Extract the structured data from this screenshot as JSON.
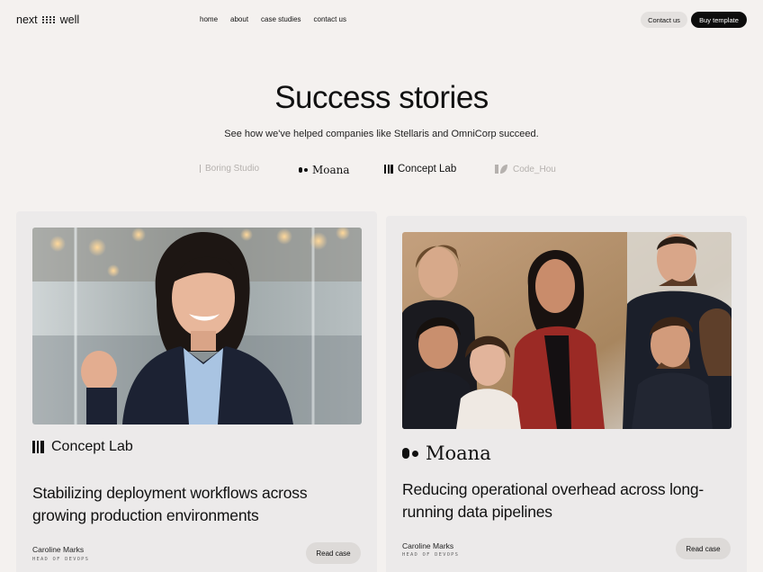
{
  "nav": {
    "logo_left": "next",
    "logo_right": "well",
    "links": [
      "home",
      "about",
      "case studies",
      "contact us"
    ],
    "contact_label": "Contact us",
    "buy_label": "Buy template"
  },
  "hero": {
    "title": "Success stories",
    "subtitle": "See how we've helped companies like Stellaris and OmniCorp succeed."
  },
  "logo_strip": [
    {
      "name": "Boring Studio",
      "icon": "boring-studio-icon"
    },
    {
      "name": "Moana",
      "icon": "moana-icon"
    },
    {
      "name": "Concept Lab",
      "icon": "concept-lab-icon"
    },
    {
      "name": "Code_Hou",
      "icon": "code-house-icon"
    }
  ],
  "cards": [
    {
      "brand": "Concept Lab",
      "brand_icon": "concept-lab-icon",
      "title": "Stabilizing deployment workflows across growing production environments",
      "person_name": "Caroline Marks",
      "person_role": "HEAD OF DEVOPS",
      "button_label": "Read case"
    },
    {
      "brand": "Moana",
      "brand_icon": "moana-icon",
      "title": "Reducing operational overhead across long-running data pipelines",
      "person_name": "Caroline Marks",
      "person_role": "HEAD OF DEVOPS",
      "button_label": "Read case"
    }
  ],
  "colors": {
    "background": "#f4f1ef",
    "card": "#eceaea",
    "primary_button": "#0d0d0d",
    "secondary_button": "#e4e1df"
  }
}
